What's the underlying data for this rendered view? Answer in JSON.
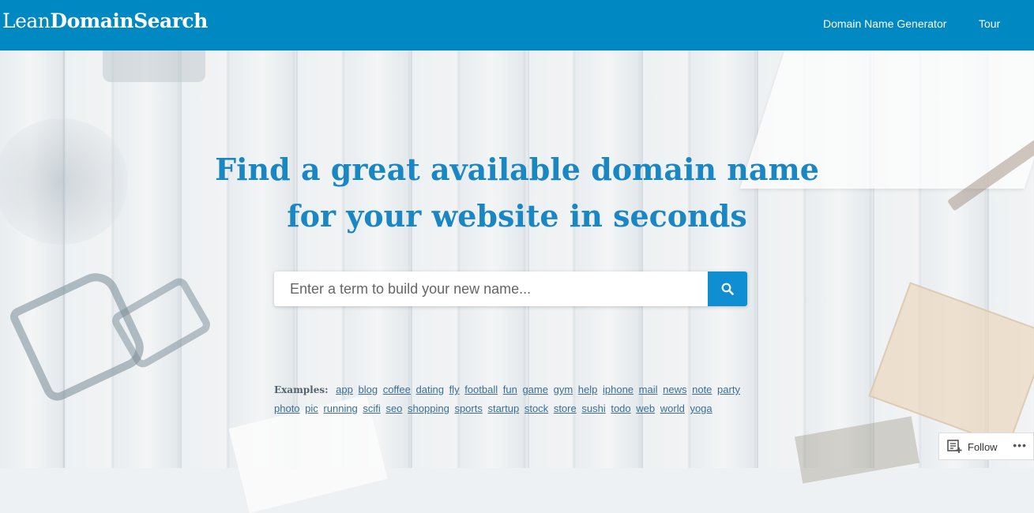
{
  "header": {
    "logo_light": "Lean",
    "logo_bold": "DomainSearch",
    "nav": [
      "Domain Name Generator",
      "Tour"
    ]
  },
  "hero": {
    "headline_line1": "Find a great available domain name",
    "headline_line2": "for your website in seconds"
  },
  "search": {
    "placeholder": "Enter a term to build your new name...",
    "button_icon": "search-icon"
  },
  "examples": {
    "label": "Examples:",
    "terms": [
      "app",
      "blog",
      "coffee",
      "dating",
      "fly",
      "football",
      "fun",
      "game",
      "gym",
      "help",
      "iphone",
      "mail",
      "news",
      "note",
      "party",
      "photo",
      "pic",
      "running",
      "scifi",
      "seo",
      "shopping",
      "sports",
      "startup",
      "stock",
      "store",
      "sushi",
      "todo",
      "web",
      "world",
      "yoga"
    ]
  },
  "follow": {
    "label": "Follow",
    "more": "•••"
  },
  "colors": {
    "header_bg": "#0088c2",
    "headline": "#1a86c2",
    "search_button": "#0f8fd1"
  }
}
